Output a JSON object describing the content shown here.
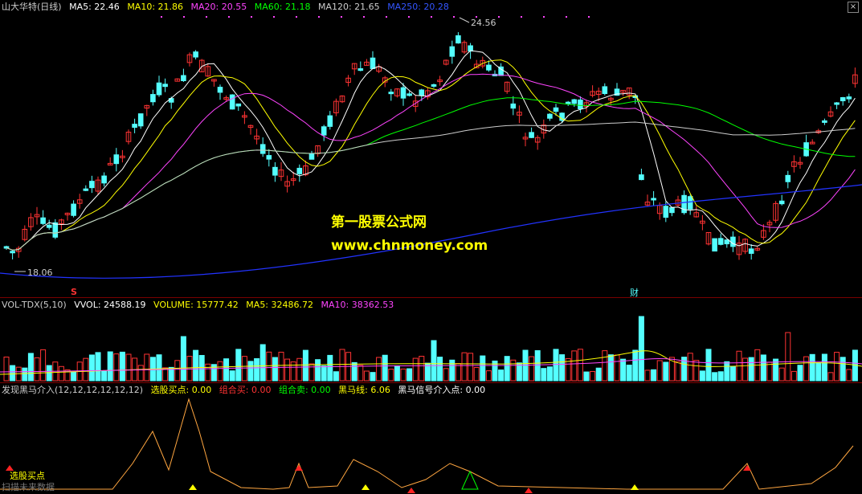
{
  "main": {
    "title": "山大华特(日线)",
    "ma": [
      {
        "label": "MA5: 22.46",
        "color": "#ffffff"
      },
      {
        "label": "MA10: 21.86",
        "color": "#ffff00"
      },
      {
        "label": "MA20: 20.55",
        "color": "#ff44ff"
      },
      {
        "label": "MA60: 21.18",
        "color": "#00ff00"
      },
      {
        "label": "MA120: 21.65",
        "color": "#cccccc"
      },
      {
        "label": "MA250: 20.28",
        "color": "#3355ff"
      }
    ],
    "high_label": "24.56",
    "low_label": "18.06",
    "cai_label": "财",
    "s_label": "S"
  },
  "watermark": {
    "line1": "第一股票公式网",
    "line2": "www.chnmoney.com"
  },
  "volume": {
    "title": "VOL-TDX(5,10)",
    "items": [
      {
        "label": "VVOL: 24588.19",
        "color": "#ffffff"
      },
      {
        "label": "VOLUME: 15777.42",
        "color": "#ffff00"
      },
      {
        "label": "MA5: 32486.72",
        "color": "#ffff00"
      },
      {
        "label": "MA10: 38362.53",
        "color": "#ff44ff"
      }
    ]
  },
  "indicator": {
    "title": "发现黑马介入(12,12,12,12,12,12)",
    "items": [
      {
        "label": "选股买点: 0.00",
        "color": "#ffff00"
      },
      {
        "label": "组合买: 0.00",
        "color": "#ff3333"
      },
      {
        "label": "组合卖: 0.00",
        "color": "#00ff00"
      },
      {
        "label": "黑马线: 6.06",
        "color": "#ffff00"
      },
      {
        "label": "黑马信号介入点: 0.00",
        "color": "#ffffff"
      }
    ],
    "buy_label": "选股买点",
    "footer": "扫描未来数据"
  },
  "colors": {
    "up": "#ff3333",
    "down": "#54ffff",
    "grid": "#7a0000"
  }
}
